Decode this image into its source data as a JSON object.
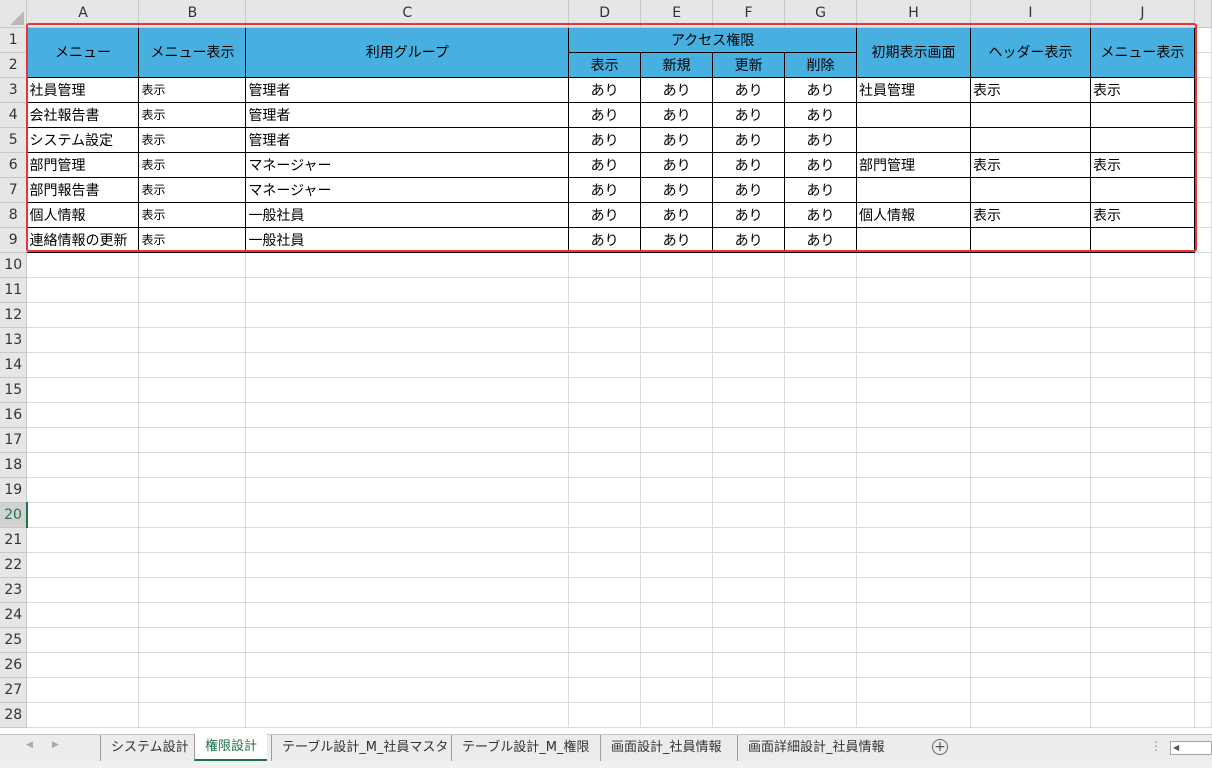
{
  "columns": [
    "A",
    "B",
    "C",
    "D",
    "E",
    "F",
    "G",
    "H",
    "I",
    "J"
  ],
  "row_numbers": [
    "1",
    "2",
    "3",
    "4",
    "5",
    "6",
    "7",
    "8",
    "9",
    "10",
    "11",
    "12",
    "13",
    "14",
    "15",
    "16",
    "17",
    "18",
    "19",
    "20",
    "21",
    "22",
    "23",
    "24",
    "25",
    "26",
    "27",
    "28"
  ],
  "selected_row": "20",
  "header": {
    "menu": "メニュー",
    "menu_display": "メニュー表示",
    "group": "利用グループ",
    "access": "アクセス権限",
    "initial_screen": "初期表示画面",
    "header_display": "ヘッダー表示",
    "menu_display2": "メニュー表示",
    "access_sub": [
      "表示",
      "新規",
      "更新",
      "削除"
    ]
  },
  "rows": [
    {
      "menu": "社員管理",
      "display": "表示",
      "group": "管理者",
      "view": "あり",
      "create": "あり",
      "update": "あり",
      "delete": "あり",
      "initial": "社員管理",
      "header_disp": "表示",
      "menu_disp": "表示"
    },
    {
      "menu": "会社報告書",
      "display": "表示",
      "group": "管理者",
      "view": "あり",
      "create": "あり",
      "update": "あり",
      "delete": "あり",
      "initial": "",
      "header_disp": "",
      "menu_disp": ""
    },
    {
      "menu": "システム設定",
      "display": "表示",
      "group": "管理者",
      "view": "あり",
      "create": "あり",
      "update": "あり",
      "delete": "あり",
      "initial": "",
      "header_disp": "",
      "menu_disp": ""
    },
    {
      "menu": "部門管理",
      "display": "表示",
      "group": "マネージャー",
      "view": "あり",
      "create": "あり",
      "update": "あり",
      "delete": "あり",
      "initial": "部門管理",
      "header_disp": "表示",
      "menu_disp": "表示"
    },
    {
      "menu": "部門報告書",
      "display": "表示",
      "group": "マネージャー",
      "view": "あり",
      "create": "あり",
      "update": "あり",
      "delete": "あり",
      "initial": "",
      "header_disp": "",
      "menu_disp": ""
    },
    {
      "menu": "個人情報",
      "display": "表示",
      "group": "一般社員",
      "view": "あり",
      "create": "あり",
      "update": "あり",
      "delete": "あり",
      "initial": "個人情報",
      "header_disp": "表示",
      "menu_disp": "表示"
    },
    {
      "menu": "連絡情報の更新",
      "display": "表示",
      "group": "一般社員",
      "view": "あり",
      "create": "あり",
      "update": "あり",
      "delete": "あり",
      "initial": "",
      "header_disp": "",
      "menu_disp": ""
    }
  ],
  "tabs": [
    {
      "label": "システム設計",
      "active": false
    },
    {
      "label": "権限設計",
      "active": true
    },
    {
      "label": "テーブル設計_M_社員マスタ",
      "active": false
    },
    {
      "label": "テーブル設計_M_権限",
      "active": false
    },
    {
      "label": "画面設計_社員情報",
      "active": false
    },
    {
      "label": "画面詳細設計_社員情報",
      "active": false
    }
  ],
  "colors": {
    "header_fill": "#48b0e0",
    "selection_outline": "#e8353c",
    "active_accent": "#217346"
  }
}
